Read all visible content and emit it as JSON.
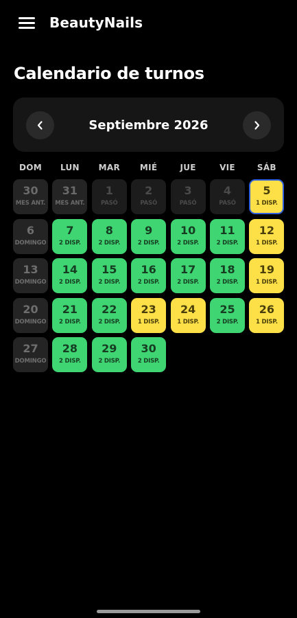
{
  "app": {
    "title": "BeautyNails"
  },
  "page": {
    "title": "Calendario de turnos"
  },
  "calendar": {
    "month_label": "Septiembre 2026",
    "weekdays": [
      "DOM",
      "LUN",
      "MAR",
      "MIÉ",
      "JUE",
      "VIE",
      "SÁB"
    ],
    "days": [
      {
        "num": "30",
        "label": "MES ANT.",
        "state": "prev"
      },
      {
        "num": "31",
        "label": "MES ANT.",
        "state": "prev"
      },
      {
        "num": "1",
        "label": "PASÓ",
        "state": "past"
      },
      {
        "num": "2",
        "label": "PASÓ",
        "state": "past"
      },
      {
        "num": "3",
        "label": "PASÓ",
        "state": "past"
      },
      {
        "num": "4",
        "label": "PASÓ",
        "state": "past"
      },
      {
        "num": "5",
        "label": "1 DISP.",
        "state": "yellow",
        "selected": true
      },
      {
        "num": "6",
        "label": "DOMINGO",
        "state": "sunday"
      },
      {
        "num": "7",
        "label": "2 DISP.",
        "state": "green"
      },
      {
        "num": "8",
        "label": "2 DISP.",
        "state": "green"
      },
      {
        "num": "9",
        "label": "2 DISP.",
        "state": "green"
      },
      {
        "num": "10",
        "label": "2 DISP.",
        "state": "green"
      },
      {
        "num": "11",
        "label": "2 DISP.",
        "state": "green"
      },
      {
        "num": "12",
        "label": "1 DISP.",
        "state": "yellow"
      },
      {
        "num": "13",
        "label": "DOMINGO",
        "state": "sunday"
      },
      {
        "num": "14",
        "label": "2 DISP.",
        "state": "green"
      },
      {
        "num": "15",
        "label": "2 DISP.",
        "state": "green"
      },
      {
        "num": "16",
        "label": "2 DISP.",
        "state": "green"
      },
      {
        "num": "17",
        "label": "2 DISP.",
        "state": "green"
      },
      {
        "num": "18",
        "label": "2 DISP.",
        "state": "green"
      },
      {
        "num": "19",
        "label": "1 DISP.",
        "state": "yellow"
      },
      {
        "num": "20",
        "label": "DOMINGO",
        "state": "sunday"
      },
      {
        "num": "21",
        "label": "2 DISP.",
        "state": "green"
      },
      {
        "num": "22",
        "label": "2 DISP.",
        "state": "green"
      },
      {
        "num": "23",
        "label": "1 DISP.",
        "state": "yellow"
      },
      {
        "num": "24",
        "label": "1 DISP.",
        "state": "yellow"
      },
      {
        "num": "25",
        "label": "2 DISP.",
        "state": "green"
      },
      {
        "num": "26",
        "label": "1 DISP.",
        "state": "yellow"
      },
      {
        "num": "27",
        "label": "DOMINGO",
        "state": "sunday"
      },
      {
        "num": "28",
        "label": "2 DISP.",
        "state": "green"
      },
      {
        "num": "29",
        "label": "2 DISP.",
        "state": "green"
      },
      {
        "num": "30",
        "label": "2 DISP.",
        "state": "green"
      }
    ]
  },
  "icons": {
    "menu": "hamburger-menu-icon",
    "prev": "chevron-left-icon",
    "next": "chevron-right-icon"
  },
  "colors": {
    "available": "#3ed572",
    "limited": "#fde047",
    "selected_border": "#2f5fdc",
    "background": "#000000"
  }
}
